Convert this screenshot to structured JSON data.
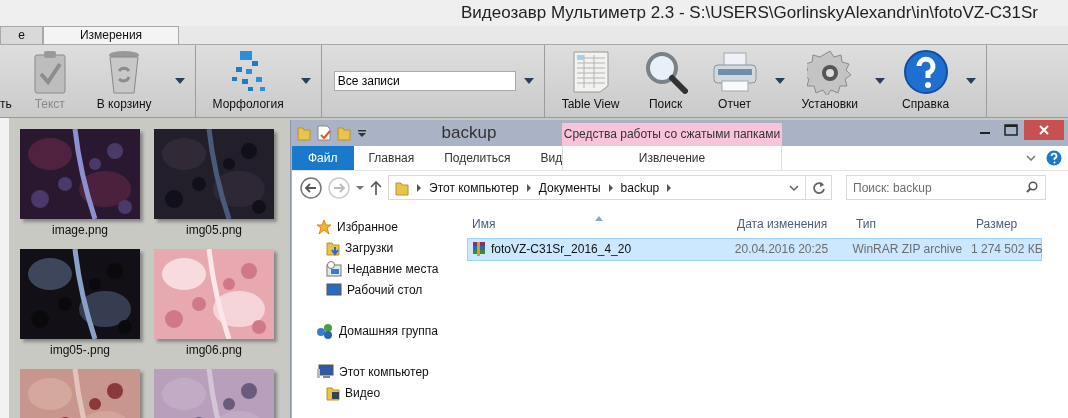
{
  "app": {
    "title": "Видеозавр Мультиметр 2.3 - S:\\USERS\\GorlinskyAlexandr\\in\\fotoVZ-C31Sr",
    "tabs": [
      {
        "label": "е",
        "selected": true
      },
      {
        "label": "Измерения",
        "selected": false
      }
    ],
    "toolbar_groups": [
      {
        "items": [
          {
            "kind": "button",
            "label": "ть",
            "disabled": false,
            "has_menu": false
          },
          {
            "kind": "button",
            "label": "Текст",
            "disabled": true,
            "has_menu": false
          },
          {
            "kind": "button",
            "label": "В корзину",
            "disabled": false,
            "has_menu": true
          }
        ]
      },
      {
        "items": [
          {
            "kind": "button",
            "label": "Морфология",
            "disabled": false,
            "has_menu": true
          }
        ]
      },
      {
        "items": [
          {
            "kind": "combo",
            "value": "Все записи"
          }
        ]
      },
      {
        "items": [
          {
            "kind": "button",
            "label": "Table View",
            "disabled": false,
            "has_menu": false
          },
          {
            "kind": "button",
            "label": "Поиск",
            "disabled": false,
            "has_menu": false
          },
          {
            "kind": "button",
            "label": "Отчет",
            "disabled": false,
            "has_menu": true
          },
          {
            "kind": "button",
            "label": "Установки",
            "disabled": false,
            "has_menu": true
          },
          {
            "kind": "button",
            "label": "Справка",
            "disabled": false,
            "has_menu": true
          }
        ]
      }
    ],
    "thumbnails": [
      {
        "kind": "picture",
        "caption": "image.png"
      },
      {
        "kind": "picture",
        "caption": "img05.png"
      },
      {
        "kind": "picture",
        "caption": "img05-.png"
      },
      {
        "kind": "picture",
        "caption": "img06.png"
      },
      {
        "kind": "picture"
      },
      {
        "kind": "picture"
      }
    ]
  },
  "explorer": {
    "title": "backup",
    "context_header": "Средства работы со сжатыми папками",
    "ribbon_tabs": [
      {
        "kind": "file",
        "label": "Файл"
      },
      {
        "kind": "tab",
        "label": "Главная"
      },
      {
        "kind": "tab",
        "label": "Поделиться"
      },
      {
        "kind": "tab",
        "label": "Вид"
      },
      {
        "kind": "context",
        "label": "Извлечение"
      }
    ],
    "breadcrumb": [
      "Этот компьютер",
      "Документы",
      "backup"
    ],
    "search": {
      "placeholder": "Поиск: backup"
    },
    "nav": [
      {
        "label": "Избранное",
        "children": [
          {
            "label": "Загрузки"
          },
          {
            "label": "Недавние места"
          },
          {
            "label": "Рабочий стол"
          }
        ]
      },
      {
        "label": "Домашняя группа"
      },
      {
        "label": "Этот компьютер",
        "children": [
          {
            "label": "Видео"
          }
        ]
      }
    ],
    "columns": [
      "Имя",
      "Дата изменения",
      "Тип",
      "Размер"
    ],
    "rows": [
      {
        "cells": [
          "fotoVZ-C31Sr_2016_4_20",
          "20.04.2016 20:25",
          "WinRAR ZIP archive",
          "1 274 502 КБ"
        ],
        "selected": true
      }
    ]
  }
}
